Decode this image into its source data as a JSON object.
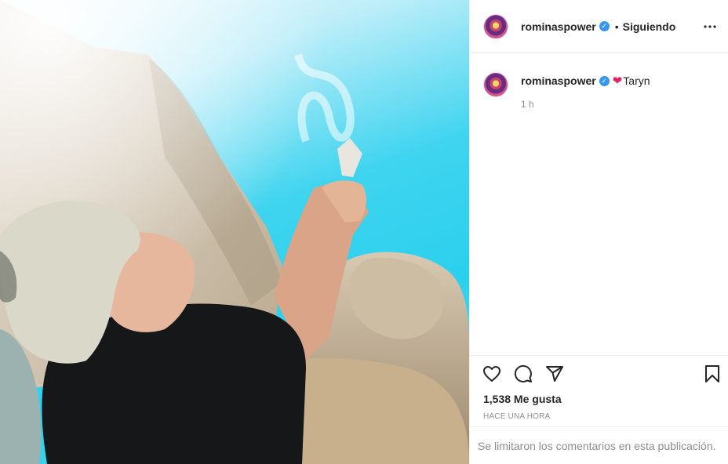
{
  "post": {
    "username": "rominaspower",
    "follow_status": "Siguiendo",
    "dot": "•",
    "caption_text": "Taryn",
    "caption_time": "1 h",
    "likes": "1,538 Me gusta",
    "date_label": "HACE UNA HORA",
    "comments_disabled": "Se limitaron los comentarios en esta publicación."
  },
  "icons": {
    "verified": "verified-badge-icon",
    "more": "more-options-icon",
    "like": "heart-icon",
    "comment": "comment-icon",
    "share": "share-icon",
    "save": "bookmark-icon",
    "caption_emoji": "red-heart-emoji"
  },
  "colors": {
    "verified": "#3897f0",
    "secondary_text": "#8e8e8e",
    "border": "#efefef",
    "heart": "#e0245e"
  }
}
